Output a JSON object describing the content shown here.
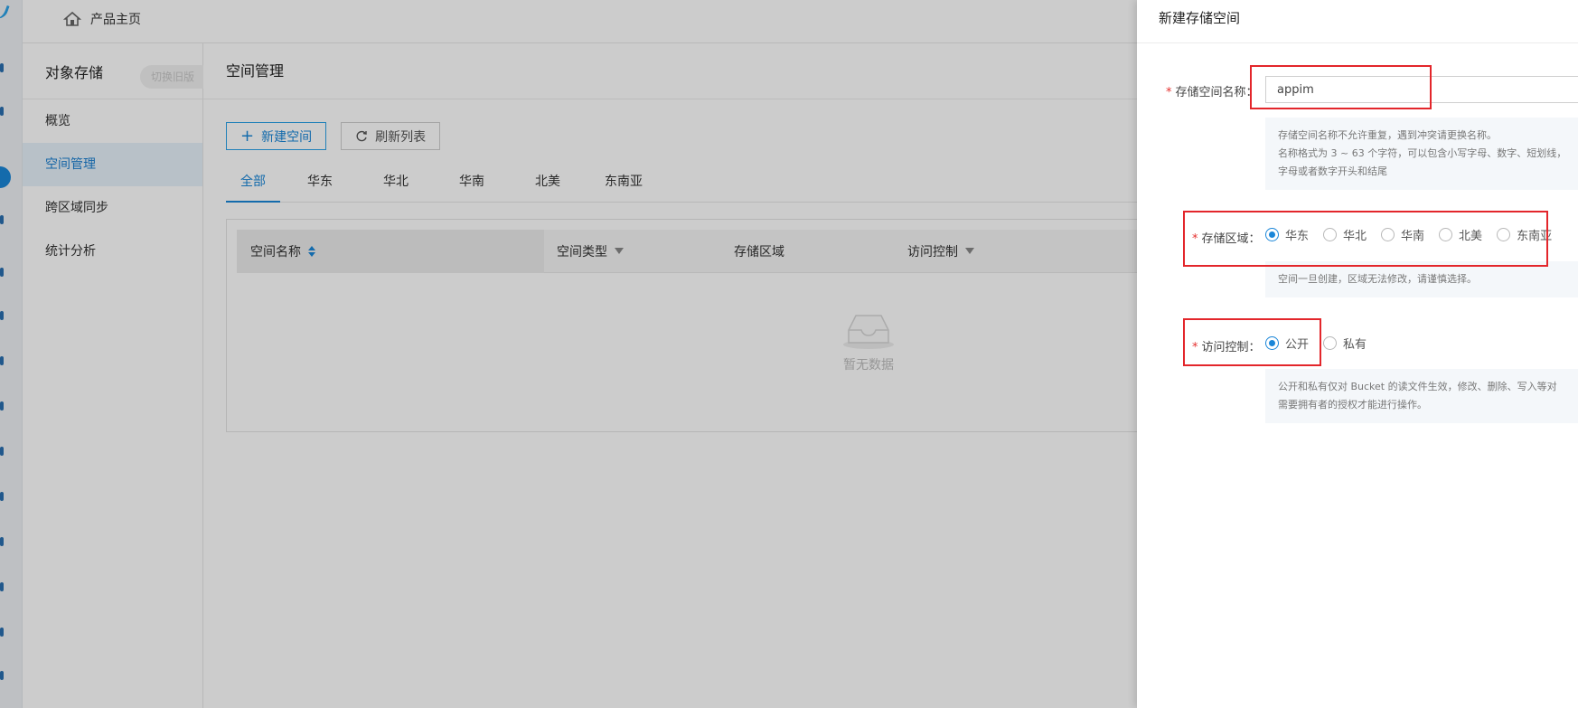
{
  "topbar": {
    "home_label": "产品主页"
  },
  "sidebar": {
    "title": "对象存储",
    "switch_label": "切换旧版",
    "items": [
      {
        "label": "概览",
        "active": false
      },
      {
        "label": "空间管理",
        "active": true
      },
      {
        "label": "跨区域同步",
        "active": false
      },
      {
        "label": "统计分析",
        "active": false
      }
    ]
  },
  "main": {
    "title": "空间管理",
    "new_button": "新建空间",
    "refresh_button": "刷新列表",
    "tabs": [
      "全部",
      "华东",
      "华北",
      "华南",
      "北美",
      "东南亚"
    ],
    "active_tab": "全部",
    "columns": [
      "空间名称",
      "空间类型",
      "存储区域",
      "访问控制"
    ],
    "empty_text": "暂无数据"
  },
  "drawer": {
    "title": "新建存储空间",
    "name_label": "存储空间名称：",
    "name_value": "appim",
    "name_hint_1": "存储空间名称不允许重复，遇到冲突请更换名称。",
    "name_hint_2": "名称格式为 3 ~ 63 个字符，可以包含小写字母、数字、短划线，",
    "name_hint_3": "字母或者数字开头和结尾",
    "region_label": "存储区域：",
    "regions": [
      "华东",
      "华北",
      "华南",
      "北美",
      "东南亚"
    ],
    "selected_region": "华东",
    "region_hint": "空间一旦创建，区域无法修改，请谨慎选择。",
    "acl_label": "访问控制：",
    "acl_options": [
      "公开",
      "私有"
    ],
    "selected_acl": "公开",
    "acl_hint_1": "公开和私有仅对 Bucket 的读文件生效，修改、删除、写入等对",
    "acl_hint_2": "需要拥有者的授权才能进行操作。"
  },
  "colors": {
    "accent": "#1a86d8",
    "highlight": "#e3262b",
    "required": "#e5302f"
  }
}
